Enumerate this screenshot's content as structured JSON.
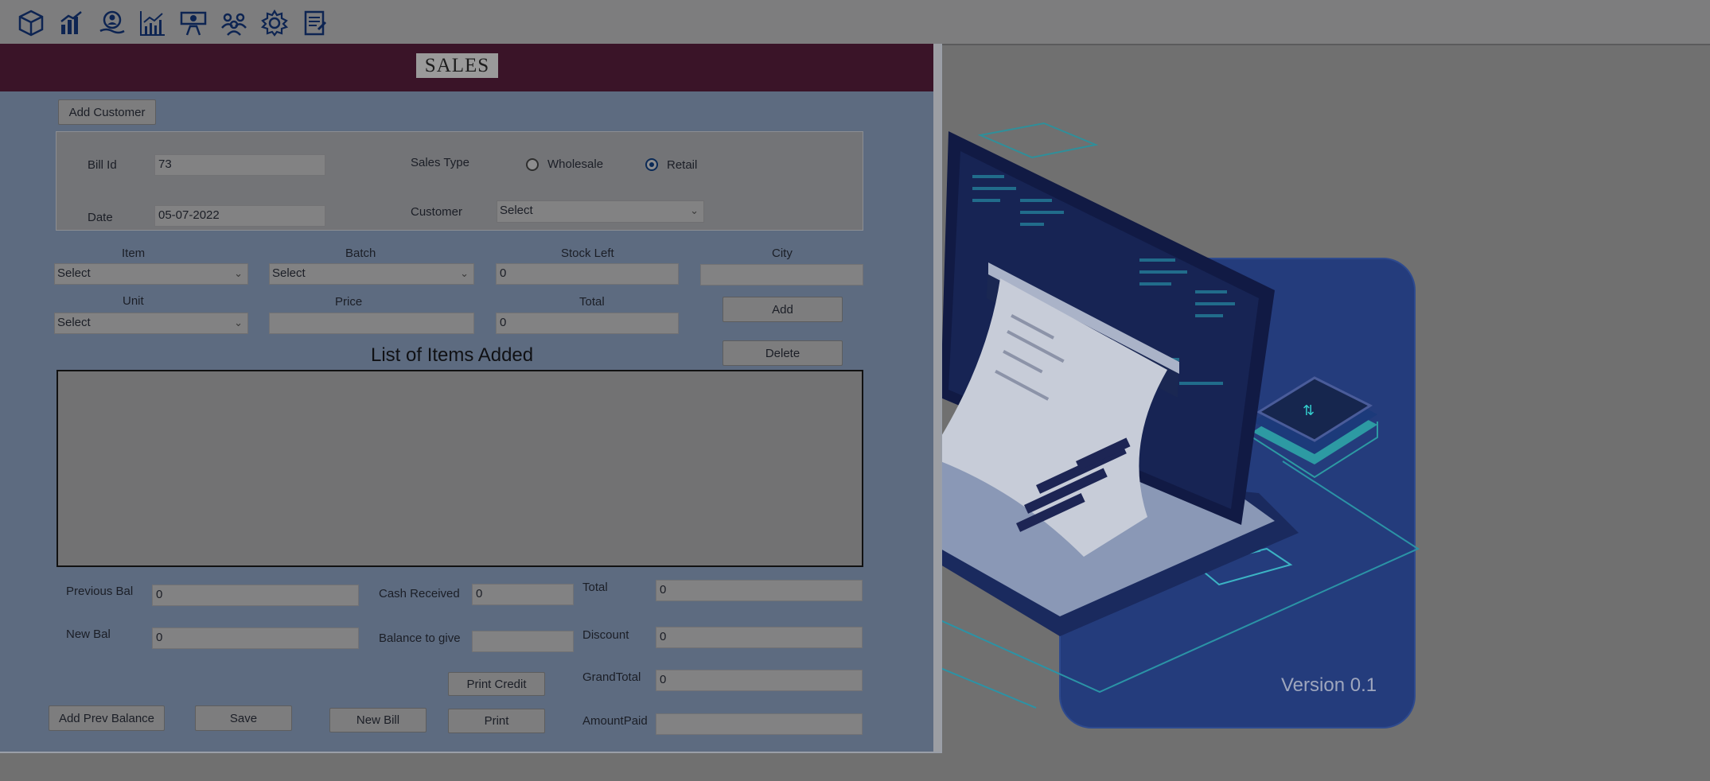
{
  "toolbar": {
    "icons": [
      "box-icon",
      "bar-chart-icon",
      "user-payment-icon",
      "line-chart-icon",
      "handshake-icon",
      "team-icon",
      "gear-icon",
      "report-icon"
    ]
  },
  "window": {
    "title": "SALES"
  },
  "buttons": {
    "add_customer": "Add Customer",
    "add": "Add",
    "delete": "Delete",
    "print_credit": "Print Credit",
    "add_prev_balance": "Add Prev Balance",
    "save": "Save",
    "new_bill": "New Bill",
    "print": "Print"
  },
  "bill": {
    "bill_id_label": "Bill Id",
    "bill_id_value": "73",
    "date_label": "Date",
    "date_value": "05-07-2022",
    "sales_type_label": "Sales Type",
    "sales_type_options": [
      "Wholesale",
      "Retail"
    ],
    "sales_type_selected": "Retail",
    "customer_label": "Customer",
    "customer_value": "Select"
  },
  "entry": {
    "item_label": "Item",
    "item_value": "Select",
    "batch_label": "Batch",
    "batch_value": "Select",
    "stock_left_label": "Stock Left",
    "stock_left_value": "0",
    "city_label": "City",
    "city_value": "",
    "unit_label": "Unit",
    "unit_value": "Select",
    "price_label": "Price",
    "price_value": "",
    "total_label": "Total",
    "total_value": "0"
  },
  "list": {
    "title": "List of Items Added"
  },
  "summary": {
    "previous_bal_label": "Previous Bal",
    "previous_bal_value": "0",
    "new_bal_label": "New Bal",
    "new_bal_value": "0",
    "cash_received_label": "Cash Received",
    "cash_received_value": "0",
    "balance_to_give_label": "Balance to give",
    "balance_to_give_value": "",
    "total_label": "Total",
    "total_value": "0",
    "discount_label": "Discount",
    "discount_value": "0",
    "grand_total_label": "GrandTotal",
    "grand_total_value": "0",
    "amount_paid_label": "AmountPaid",
    "amount_paid_value": ""
  },
  "illustration": {
    "version": "Version 0.1"
  },
  "colors": {
    "title_bar": "#3a1428",
    "form_bg": "#5d6b80",
    "desktop_bg": "#707070"
  }
}
